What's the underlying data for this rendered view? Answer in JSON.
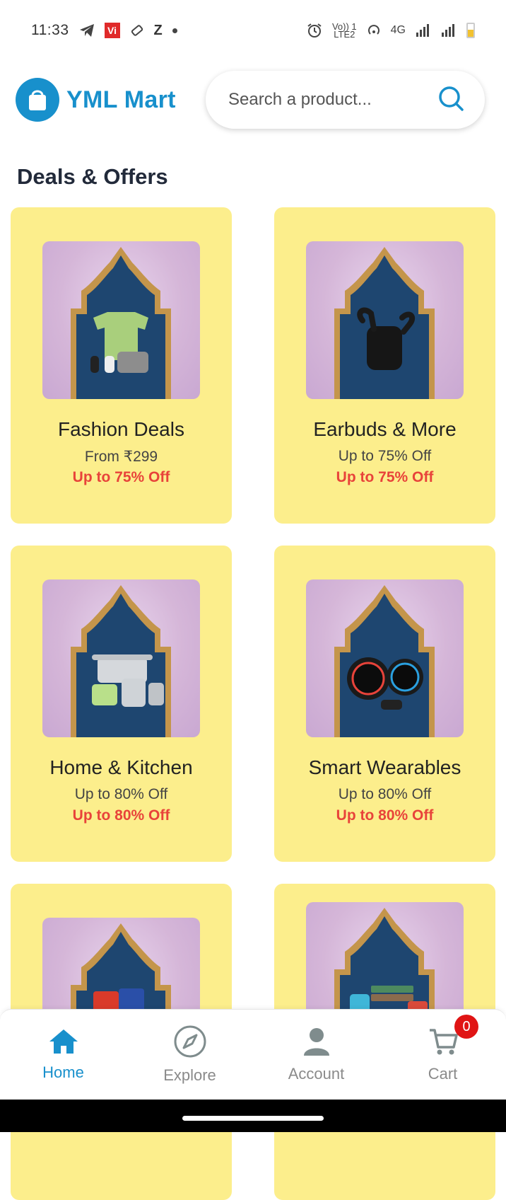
{
  "status_bar": {
    "time": "11:33",
    "carrier_badge": "Vi",
    "extra_icon": "Z",
    "volte_top": "Vo)) 1",
    "volte_bottom": "LTE2",
    "network": "4G"
  },
  "header": {
    "brand": "YML Mart",
    "search_placeholder": "Search a product..."
  },
  "section": {
    "title": "Deals & Offers"
  },
  "deals": [
    {
      "title": "Fashion Deals",
      "subtitle": "From ₹299",
      "offer": "Up to 75% Off",
      "image": "fashion-products"
    },
    {
      "title": "Earbuds & More",
      "subtitle": "Up to 75% Off",
      "offer": "Up to 75% Off",
      "image": "earbuds"
    },
    {
      "title": "Home & Kitchen",
      "subtitle": "Up to 80% Off",
      "offer": "Up to 80% Off",
      "image": "cookware"
    },
    {
      "title": "Smart Wearables",
      "subtitle": "Up to 80% Off",
      "offer": "Up to 80% Off",
      "image": "smartwatches"
    },
    {
      "title": "",
      "subtitle": "",
      "offer": "",
      "image": "snacks"
    },
    {
      "title": "",
      "subtitle": "",
      "offer": "",
      "image": "luggage"
    }
  ],
  "bottom_nav": {
    "items": [
      {
        "label": "Home",
        "icon": "home-icon",
        "active": true
      },
      {
        "label": "Explore",
        "icon": "compass-icon",
        "active": false
      },
      {
        "label": "Account",
        "icon": "user-icon",
        "active": false
      },
      {
        "label": "Cart",
        "icon": "cart-icon",
        "active": false
      }
    ],
    "cart_count": "0"
  },
  "colors": {
    "brand": "#1890cc",
    "card_bg": "#fcee8c",
    "offer_red": "#e8433a",
    "badge_red": "#e01414"
  }
}
